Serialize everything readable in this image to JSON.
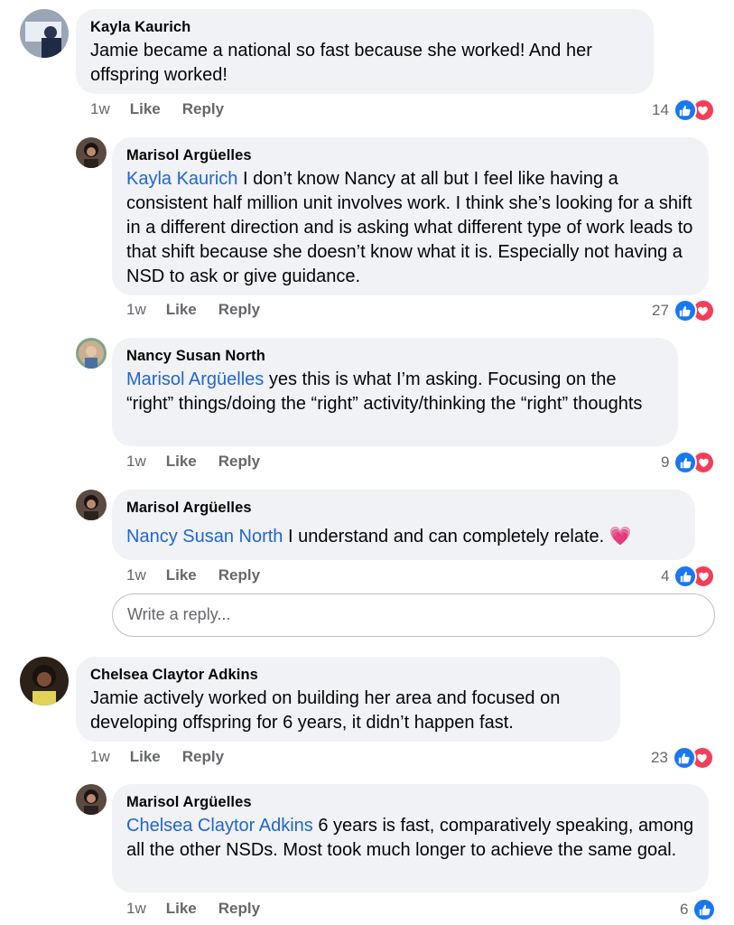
{
  "comments": [
    {
      "author": "Kayla Kaurich",
      "mention": "",
      "text": "Jamie became a national so fast because she worked! And her offspring worked!",
      "time": "1w",
      "like": "Like",
      "reply": "Reply",
      "reactions": "14"
    },
    {
      "author": "Marisol Argüelles",
      "mention": "Kayla Kaurich",
      "text": " I don’t know Nancy at all but I feel like having a consistent half million unit involves work. I think she’s looking for a shift in a different direction and is asking what different type of work leads to that shift because she doesn’t know what it is. Especially not having a NSD to ask or give guidance.",
      "time": "1w",
      "like": "Like",
      "reply": "Reply",
      "reactions": "27"
    },
    {
      "author": "Nancy Susan North",
      "mention": "Marisol Argüelles",
      "text": " yes this is what I’m asking. Focusing on the “right” things/doing the “right” activity/thinking the “right” thoughts",
      "time": "1w",
      "like": "Like",
      "reply": "Reply",
      "reactions": "9"
    },
    {
      "author": "Marisol Argüelles",
      "mention": "Nancy Susan North",
      "text": " I understand and can completely relate.",
      "emoji": "💗",
      "time": "1w",
      "like": "Like",
      "reply": "Reply",
      "reactions": "4"
    },
    {
      "author": "Chelsea Claytor Adkins",
      "mention": "",
      "text": "Jamie actively worked on building her area and focused on developing offspring for 6 years, it didn’t happen fast.",
      "time": "1w",
      "like": "Like",
      "reply": "Reply",
      "reactions": "23"
    },
    {
      "author": "Marisol Argüelles",
      "mention": "Chelsea Claytor Adkins",
      "text": " 6 years is fast, comparatively speaking, among all the other NSDs. Most took much longer to achieve the same goal.",
      "time": "1w",
      "like": "Like",
      "reply": "Reply",
      "reactions": "6"
    }
  ],
  "reply_box": {
    "placeholder": "Write a reply..."
  },
  "colors": {
    "bubble": "#f0f2f5",
    "mention": "#1f65d2",
    "like": "#1877f2",
    "love": "#f33e58"
  }
}
